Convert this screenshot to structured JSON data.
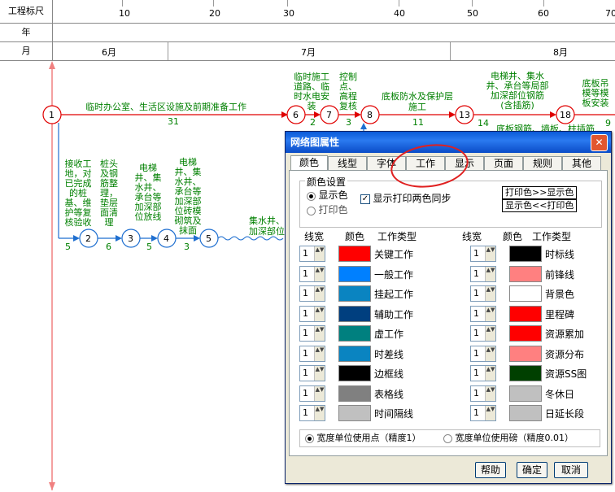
{
  "ruler": {
    "scale_label": "工程标尺",
    "year_label": "年",
    "month_label": "月",
    "scale_numbers": [
      "10",
      "20",
      "30",
      "40",
      "50",
      "60",
      "70"
    ],
    "months": [
      "6月",
      "7月",
      "8月"
    ]
  },
  "network": {
    "top_path_label": "临时办公室、生活区设施及前期准备工作",
    "top_path_duration": "31",
    "nodes": [
      "1",
      "2",
      "3",
      "4",
      "5",
      "6",
      "7",
      "8",
      "13",
      "18"
    ],
    "labels": {
      "a67": "临时施工道路、临时水电安装",
      "a67_dur": "2",
      "a78": "控制点、高程复核",
      "a78_dur": "3",
      "a813": "底板防水及保护层施工",
      "a813_dur": "11",
      "a1318": "电梯井、集水井、承台等局部加深部位钢筋(含插筋)",
      "a1318_dur": "14",
      "a18": "底板吊模等模板安装",
      "a18_dur": "9",
      "a13x": "底板钢筋、墙板、柱插筋",
      "a12": "接收工地，对已完成的桩基、维护等复核验收",
      "a12_dur": "5",
      "a23": "桩头及钢筋整理，垫层面清理",
      "a23_dur": "6",
      "a34": "电梯井、集水井、承台等加深部位放线",
      "a34_dur": "5",
      "a45": "电梯井、集水井、承台等加深部位砖模砌筑及抹面",
      "a45_dur": "3",
      "a5x": "集水井、加深部位"
    }
  },
  "dialog": {
    "title": "网络图属性",
    "close": "✕",
    "tabs": [
      "颜色",
      "线型",
      "字体",
      "工作",
      "显示",
      "页面",
      "规则",
      "其他"
    ],
    "color_group_title": "颜色设置",
    "radio_display": "显示色",
    "radio_print": "打印色",
    "sync_label": "显示打印两色同步",
    "btn_print_to_display": "打印色>>显示色",
    "btn_display_to_print": "显示色<<打印色",
    "col_width": "线宽",
    "col_color": "颜色",
    "col_type": "工作类型",
    "left_rows": [
      {
        "width": "1",
        "color": "#ff0000",
        "label": "关键工作"
      },
      {
        "width": "1",
        "color": "#0080ff",
        "label": "一般工作"
      },
      {
        "width": "1",
        "color": "#0a84c1",
        "label": "挂起工作"
      },
      {
        "width": "1",
        "color": "#003f7f",
        "label": "辅助工作"
      },
      {
        "width": "1",
        "color": "#00807f",
        "label": "虚工作"
      },
      {
        "width": "1",
        "color": "#0a84c1",
        "label": "时差线"
      },
      {
        "width": "1",
        "color": "#000000",
        "label": "边框线"
      },
      {
        "width": "1",
        "color": "#808080",
        "label": "表格线"
      },
      {
        "width": "1",
        "color": "#c0c0c0",
        "label": "时间隔线"
      }
    ],
    "right_rows": [
      {
        "width": "1",
        "color": "#000000",
        "label": "时标线"
      },
      {
        "width": "1",
        "color": "#ff8080",
        "label": "前锋线"
      },
      {
        "width": "1",
        "color": "#ffffff",
        "label": "背景色"
      },
      {
        "width": "1",
        "color": "#ff0000",
        "label": "里程碑"
      },
      {
        "width": "1",
        "color": "#ff0000",
        "label": "资源累加"
      },
      {
        "width": "1",
        "color": "#ff8080",
        "label": "资源分布"
      },
      {
        "width": "1",
        "color": "#004000",
        "label": "资源SS图"
      },
      {
        "width": "1",
        "color": "#c0c0c0",
        "label": "冬休日"
      },
      {
        "width": "1",
        "color": "#c0c0c0",
        "label": "日延长段"
      }
    ],
    "unit_point": "宽度单位使用点（精度1）",
    "unit_pound": "宽度单位使用磅（精度0.01）",
    "help": "帮助",
    "ok": "确定",
    "cancel": "取消"
  }
}
